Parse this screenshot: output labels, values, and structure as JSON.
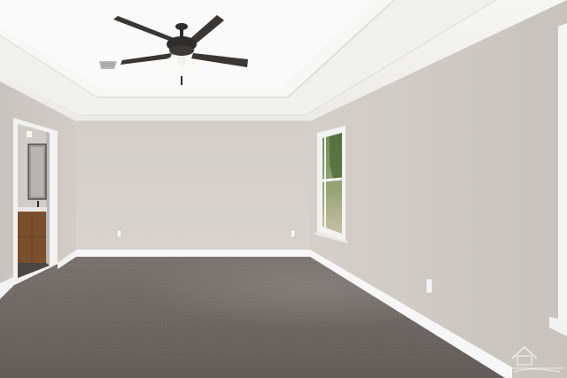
{
  "scene": {
    "subject": "empty-bedroom-interior",
    "elements": [
      "tray-ceiling",
      "ceiling-fan",
      "air-vent",
      "doorway-to-bathroom",
      "vanity-cabinet",
      "mirror",
      "window",
      "carpet-floor",
      "baseboards",
      "electrical-outlets",
      "logo-watermark"
    ]
  },
  "colors": {
    "wall_left": "#cfcbc4",
    "wall_back": "#d6d2cb",
    "wall_right": "#cdc9c2",
    "ceiling": "#f4f4f3",
    "carpet": "#6f6864",
    "baseboard": "#f7f7f7",
    "fan_dark": "#2f2d2c",
    "vanity_wood": "#7a4f2e",
    "window_glass": "#8a9a6b"
  },
  "watermark": {
    "text": "",
    "icon": "house-logo-icon"
  }
}
